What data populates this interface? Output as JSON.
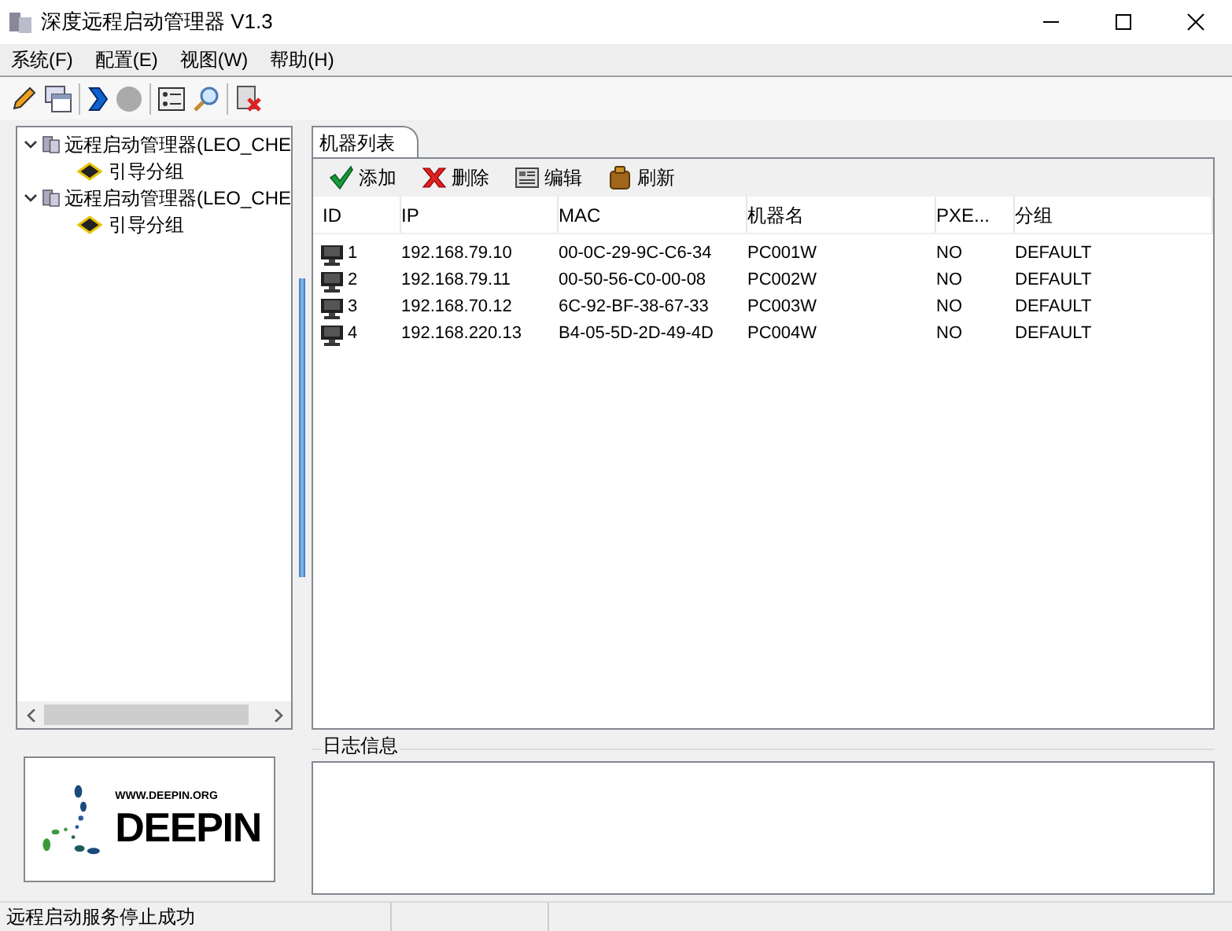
{
  "window": {
    "title": "深度远程启动管理器 V1.3"
  },
  "menu": [
    "系统(F)",
    "配置(E)",
    "视图(W)",
    "帮助(H)"
  ],
  "tree": [
    {
      "label": "远程启动管理器(LEO_CHE",
      "expanded": true,
      "children": [
        {
          "label": "引导分组"
        }
      ]
    },
    {
      "label": "远程启动管理器(LEO_CHE",
      "expanded": true,
      "children": [
        {
          "label": "引导分组"
        }
      ]
    }
  ],
  "logo": {
    "url": "WWW.DEEPIN.ORG",
    "name": "DEEPIN"
  },
  "tabs": [
    {
      "label": "机器列表",
      "selected": true
    }
  ],
  "actions": [
    {
      "kind": "add",
      "label": "添加"
    },
    {
      "kind": "delete",
      "label": "删除"
    },
    {
      "kind": "edit",
      "label": "编辑"
    },
    {
      "kind": "refresh",
      "label": "刷新"
    }
  ],
  "table": {
    "columns": [
      "ID",
      "IP",
      "MAC",
      "机器名",
      "PXE...",
      "分组"
    ],
    "rows": [
      [
        "1",
        "192.168.79.10",
        "00-0C-29-9C-C6-34",
        "PC001W",
        "NO",
        "DEFAULT"
      ],
      [
        "2",
        "192.168.79.11",
        "00-50-56-C0-00-08",
        "PC002W",
        "NO",
        "DEFAULT"
      ],
      [
        "3",
        "192.168.70.12",
        "6C-92-BF-38-67-33",
        "PC003W",
        "NO",
        "DEFAULT"
      ],
      [
        "4",
        "192.168.220.13",
        "B4-05-5D-2D-49-4D",
        "PC004W",
        "NO",
        "DEFAULT"
      ]
    ]
  },
  "log": {
    "title": "日志信息"
  },
  "status_bar": [
    "远程启动服务停止成功"
  ]
}
